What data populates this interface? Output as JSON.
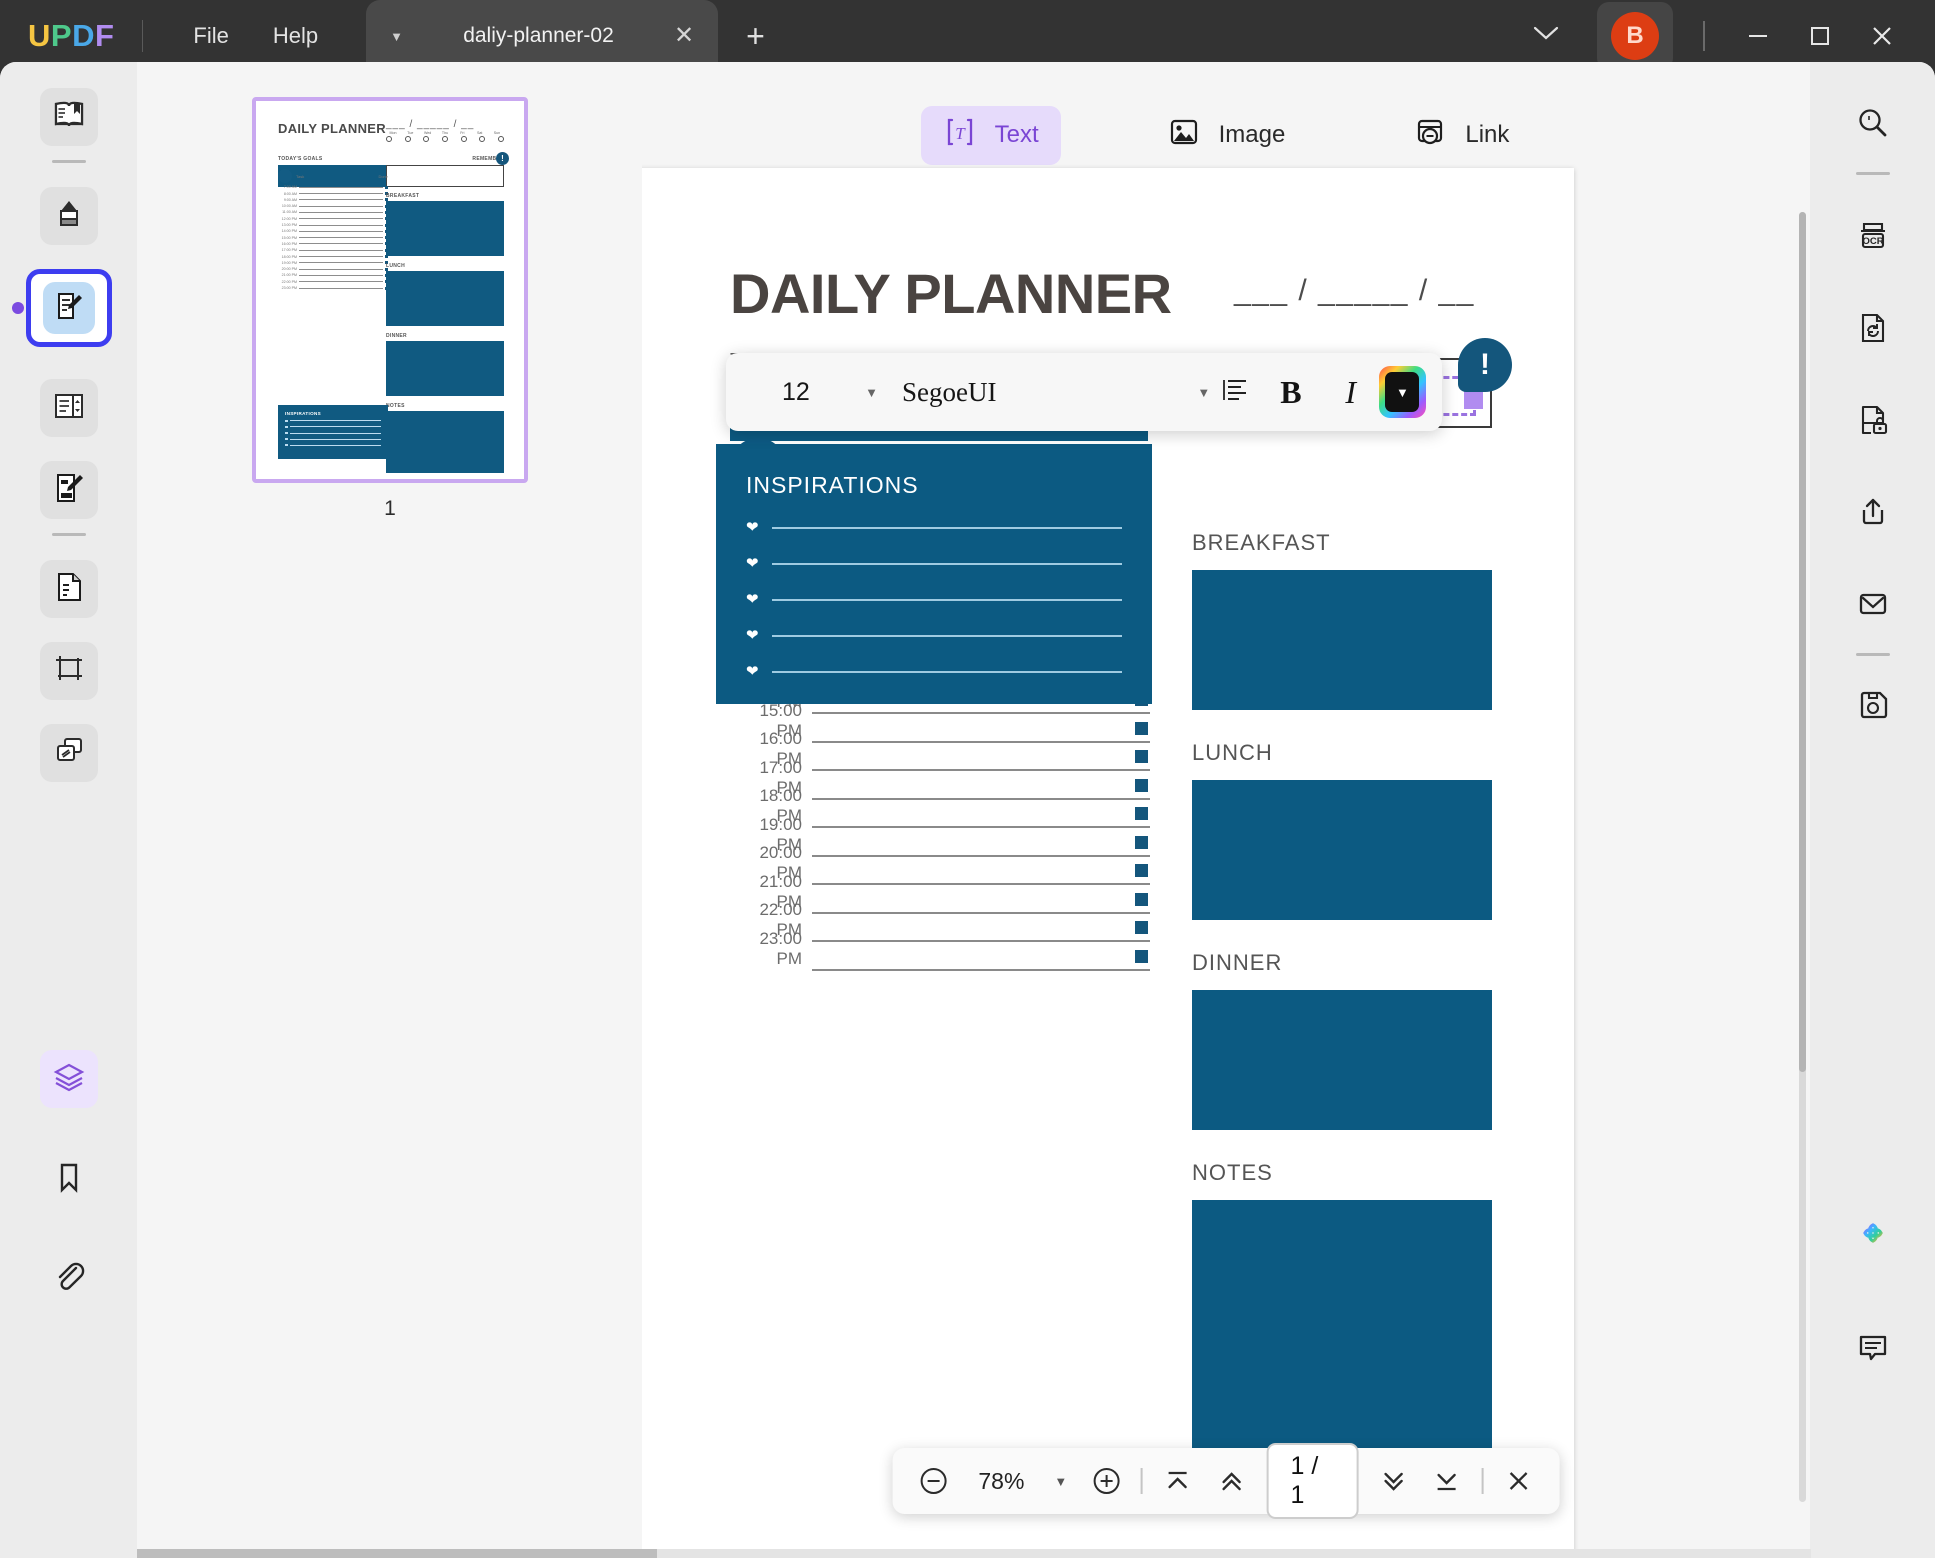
{
  "app": {
    "logo_letters": [
      "U",
      "P",
      "D",
      "F"
    ],
    "menus": [
      {
        "label": "File",
        "name": "file-menu"
      },
      {
        "label": "Help",
        "name": "help-menu"
      }
    ],
    "tab": {
      "title": "daliy-planner-02"
    },
    "avatar_initial": "B",
    "colors": {
      "brand_purple": "#7a45d4",
      "accent_blue": "#0c5a82",
      "avatar_red": "#dd3d13",
      "selection_blue": "#3d3df0"
    }
  },
  "left_rail": {
    "items": [
      {
        "name": "reader-mode-icon",
        "label": "Reader"
      },
      {
        "name": "annotate-icon",
        "label": "Annotate"
      },
      {
        "name": "edit-pdf-icon",
        "label": "Edit PDF",
        "selected": true
      },
      {
        "name": "organize-pages-icon",
        "label": "Page Organize"
      },
      {
        "name": "form-icon",
        "label": "Form"
      },
      {
        "name": "convert-doc-icon",
        "label": "Convert"
      },
      {
        "name": "crop-icon",
        "label": "Crop"
      },
      {
        "name": "compare-icon",
        "label": "Compare"
      }
    ],
    "bottom_items": [
      {
        "name": "layers-icon",
        "label": "Layers",
        "active": true
      },
      {
        "name": "bookmark-icon",
        "label": "Bookmark"
      },
      {
        "name": "attachment-icon",
        "label": "Attachment"
      }
    ]
  },
  "right_rail": {
    "items": [
      {
        "name": "search-icon",
        "label": "Search"
      },
      {
        "name": "ocr-icon",
        "label": "OCR"
      },
      {
        "name": "convert-icon",
        "label": "Convert"
      },
      {
        "name": "protect-icon",
        "label": "Protect"
      },
      {
        "name": "share-icon",
        "label": "Share"
      },
      {
        "name": "email-icon",
        "label": "Email"
      },
      {
        "name": "save-icon",
        "label": "Save"
      }
    ],
    "bottom_items": [
      {
        "name": "ai-assistant-icon",
        "label": "AI Assistant"
      },
      {
        "name": "comment-icon",
        "label": "Comment"
      }
    ]
  },
  "thumbnails": {
    "pages": [
      {
        "number": "1",
        "selected": true
      }
    ]
  },
  "object_toolbar": {
    "items": [
      {
        "label": "Text",
        "name": "tab-text",
        "icon": "text-icon",
        "active": true
      },
      {
        "label": "Image",
        "name": "tab-image",
        "icon": "image-icon",
        "active": false
      },
      {
        "label": "Link",
        "name": "tab-link",
        "icon": "link-icon",
        "active": false
      }
    ]
  },
  "font_toolbar": {
    "font_size": "12",
    "font_family": "SegoeUI",
    "align_icon": "align-left-icon",
    "bold_label": "B",
    "italic_label": "I",
    "color_picker_icon": "color-picker-icon"
  },
  "document": {
    "title": "DAILY PLANNER",
    "date_field": "___ / _____ / __",
    "weekdays": [
      "Mon",
      "Tue",
      "Wed",
      "Thu",
      "Fri",
      "Sat",
      "Sun"
    ],
    "goals_label": "TODAY'S GOALS",
    "goals_label_clipped": "T",
    "remember_label": "REMEMBER",
    "remember_badge": "!",
    "task_header": {
      "task": "Task",
      "done": "Done"
    },
    "times": [
      "7:00 AM",
      "8:00 AM",
      "9:00 AM",
      "10:00 AM",
      "11:00 AM",
      "12:00 PM",
      "13:00 PM",
      "14:00 PM",
      "15:00 PM",
      "16:00 PM",
      "17:00 PM",
      "18:00 PM",
      "19:00 PM",
      "20:00 PM",
      "21:00 PM",
      "22:00 PM",
      "23:00 PM"
    ],
    "meals": [
      {
        "label": "BREAKFAST"
      },
      {
        "label": "LUNCH"
      },
      {
        "label": "DINNER"
      },
      {
        "label": "NOTES"
      }
    ],
    "inspirations_label": "INSPIRATIONS",
    "inspiration_rows": 5
  },
  "zoom_bar": {
    "zoom_out_icon": "zoom-out-icon",
    "zoom_level": "78%",
    "zoom_in_icon": "zoom-in-icon",
    "first_page_icon": "first-page-icon",
    "prev_page_icon": "prev-page-icon",
    "page_indicator": "1 / 1",
    "next_page_icon": "next-page-icon",
    "last_page_icon": "last-page-icon",
    "close_icon": "close-icon"
  },
  "window_controls": {
    "minimize": "minimize-icon",
    "maximize": "maximize-icon",
    "close": "close-icon"
  }
}
